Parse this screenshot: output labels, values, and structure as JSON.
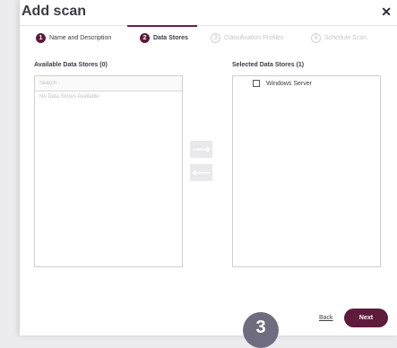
{
  "dialog": {
    "title": "Add scan"
  },
  "steps": [
    {
      "number": "1",
      "label": "Name and Description",
      "state": "done"
    },
    {
      "number": "2",
      "label": "Data Stores",
      "state": "current"
    },
    {
      "number": "3",
      "label": "Classification Profiles",
      "state": "disabled"
    },
    {
      "number": "4",
      "label": "Schedule Scan",
      "state": "disabled"
    }
  ],
  "available": {
    "label": "Available Data Stores (0)",
    "search_placeholder": "Search",
    "search_value": "",
    "empty_text": "No Data Stores Available"
  },
  "selected": {
    "label": "Selected Data Stores (1)",
    "items": [
      {
        "label": "Windows Server",
        "checked": false
      }
    ]
  },
  "transfer": {
    "add_icon": "arrow-right-icon",
    "remove_icon": "arrow-left-icon",
    "add_glyph": "⟶",
    "remove_glyph": "⟵"
  },
  "footer": {
    "badge": "3",
    "back_label": "Back",
    "next_label": "Next"
  },
  "colors": {
    "accent": "#5e1b3c",
    "badge": "#6f6c80",
    "arrow_button_bg": "#e9e9ec"
  }
}
